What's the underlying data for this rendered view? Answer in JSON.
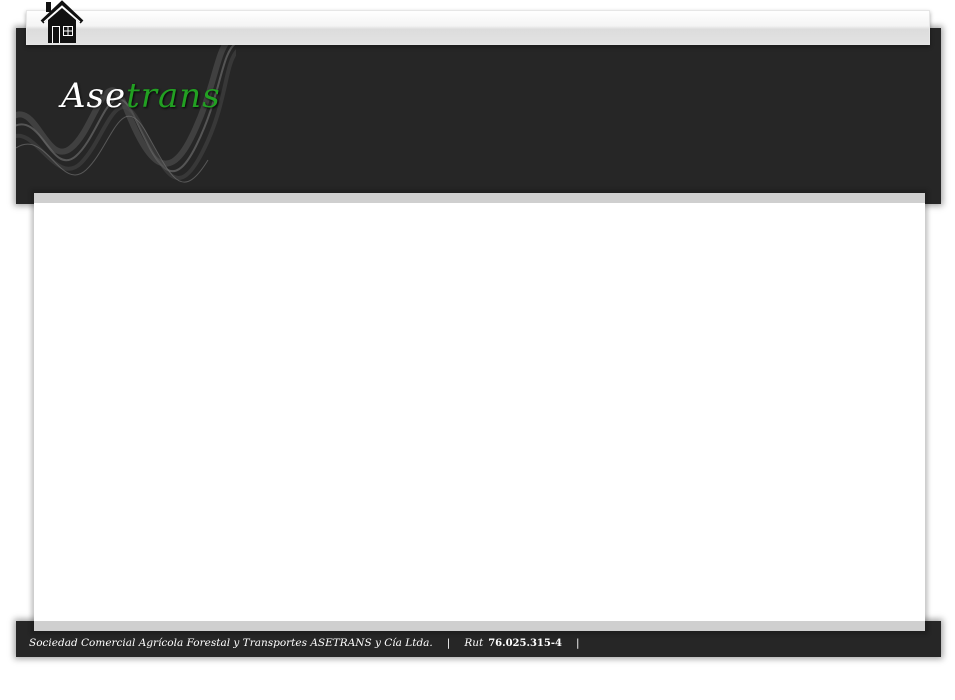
{
  "header": {
    "logo": {
      "part_a": "Ase",
      "part_b": "trans"
    },
    "home_icon": "home-icon"
  },
  "colors": {
    "header_bg": "#262626",
    "logo_accent": "#22a022",
    "content_border": "#cfcfcf"
  },
  "footer": {
    "company": "Sociedad Comercial Agrícola Forestal y Transportes ASETRANS y Cía Ltda.",
    "separator": "|",
    "rut_label": "Rut",
    "rut_value": "76.025.315-4"
  }
}
